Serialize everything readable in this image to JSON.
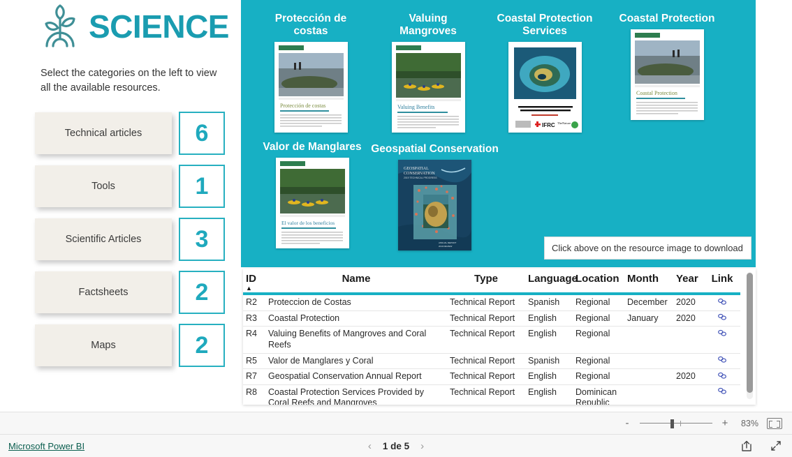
{
  "brand": {
    "title": "SCIENCE",
    "logo_icon": "sprout-plant-icon",
    "accent_color": "#1a9cb0"
  },
  "sidebar": {
    "intro_text": "Select the categories on the left to view all the available resources.",
    "categories": [
      {
        "label": "Technical articles",
        "count": "6"
      },
      {
        "label": "Tools",
        "count": "1"
      },
      {
        "label": "Scientific Articles",
        "count": "3"
      },
      {
        "label": "Factsheets",
        "count": "2"
      },
      {
        "label": "Maps",
        "count": "2"
      }
    ]
  },
  "resource_panel": {
    "background_color": "#17b0c4",
    "tooltip": "Click above on the resource image to download",
    "cards": [
      {
        "title": "Protección de costas",
        "thumb": "coastal-protection-es-cover"
      },
      {
        "title": "Valuing Mangroves",
        "thumb": "valuing-mangroves-cover"
      },
      {
        "title": "Coastal Protection Services",
        "thumb": "coastal-protection-services-cover"
      },
      {
        "title": "Coastal Protection",
        "thumb": "coastal-protection-en-cover"
      },
      {
        "title": "Valor de Manglares",
        "thumb": "valor-manglares-cover"
      },
      {
        "title": "Geospatial Conservation",
        "thumb": "geospatial-conservation-cover"
      }
    ]
  },
  "table": {
    "columns": [
      "ID",
      "Name",
      "Type",
      "Language",
      "Location",
      "Month",
      "Year",
      "Link"
    ],
    "sort_column": "ID",
    "sort_direction": "ascending",
    "link_icon": "chain-link-icon",
    "rows": [
      {
        "id": "R2",
        "name": "Proteccion de Costas",
        "type": "Technical Report",
        "language": "Spanish",
        "location": "Regional",
        "month": "December",
        "year": "2020",
        "link": "⚭"
      },
      {
        "id": "R3",
        "name": "Coastal Protection",
        "type": "Technical Report",
        "language": "English",
        "location": "Regional",
        "month": "January",
        "year": "2020",
        "link": "⚭"
      },
      {
        "id": "R4",
        "name": "Valuing Benefits of Mangroves and Coral Reefs",
        "type": "Technical Report",
        "language": "English",
        "location": "Regional",
        "month": "",
        "year": "",
        "link": "⚭"
      },
      {
        "id": "R5",
        "name": "Valor de Manglares y Coral",
        "type": "Technical Report",
        "language": "Spanish",
        "location": "Regional",
        "month": "",
        "year": "",
        "link": "⚭"
      },
      {
        "id": "R7",
        "name": "Geospatial Conservation Annual Report",
        "type": "Technical Report",
        "language": "English",
        "location": "Regional",
        "month": "",
        "year": "2020",
        "link": "⚭"
      },
      {
        "id": "R8",
        "name": "Coastal Protection Services Provided by Coral Reefs and Mangroves",
        "type": "Technical Report",
        "language": "English",
        "location": "Dominican Republic",
        "month": "",
        "year": "",
        "link": "⚭"
      }
    ]
  },
  "statusbar": {
    "zoom_out_label": "-",
    "zoom_in_label": "+",
    "zoom_percent": "83%",
    "fit_icon": "fit-to-page-icon"
  },
  "footer": {
    "powerbi_label": "Microsoft Power BI",
    "prev_icon": "‹",
    "next_icon": "›",
    "page_label": "1 de 5",
    "share_icon": "share-icon",
    "fullscreen_icon": "fullscreen-icon"
  }
}
